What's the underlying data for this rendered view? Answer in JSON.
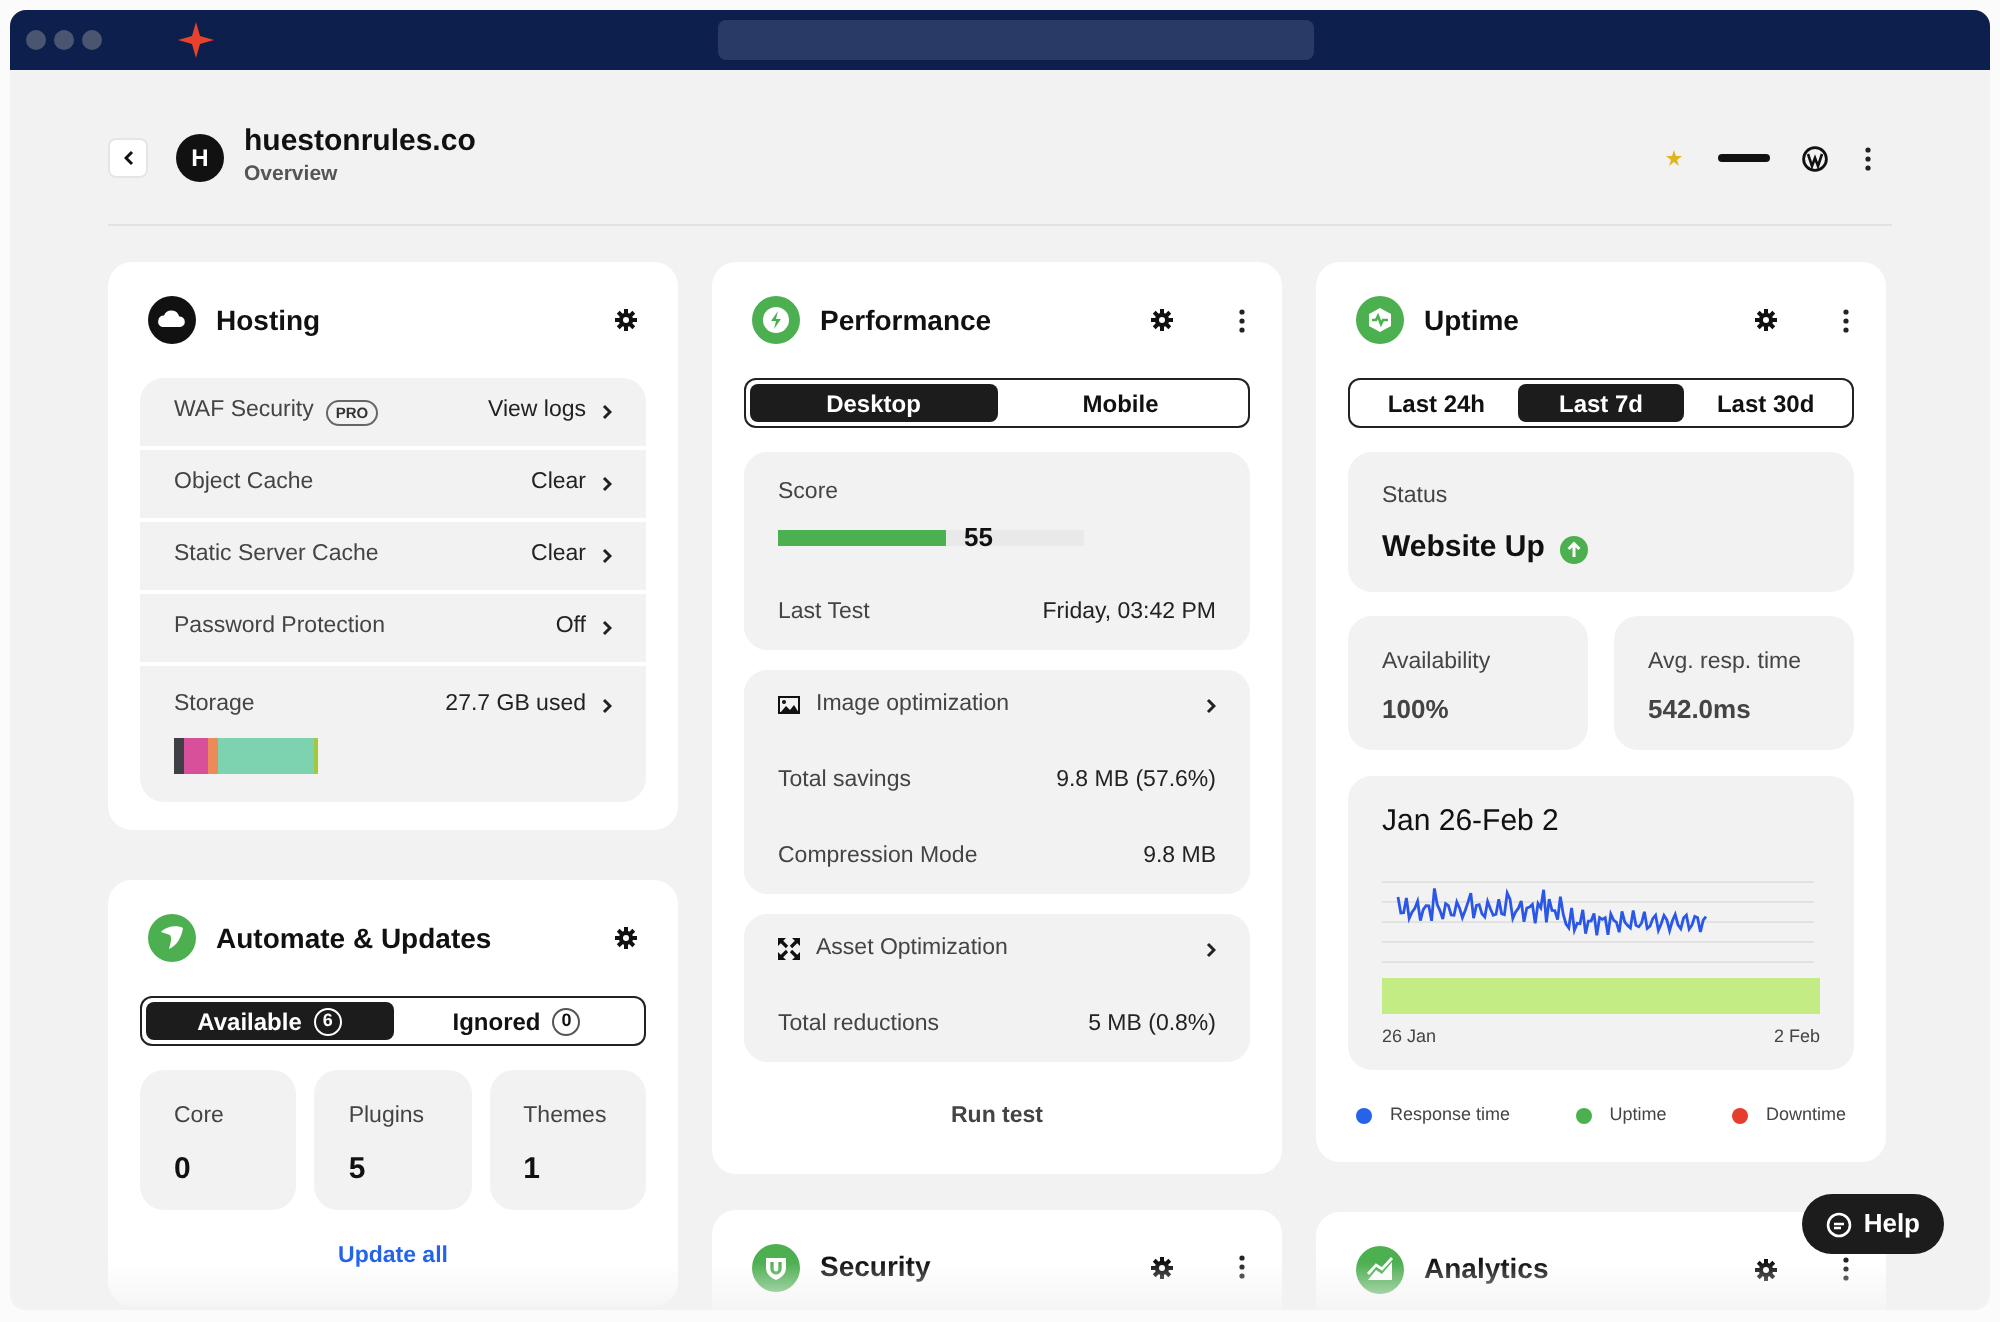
{
  "header": {
    "avatar_letter": "H",
    "site": "huestonrules.co",
    "subtitle": "Overview"
  },
  "hosting": {
    "title": "Hosting",
    "rows": [
      {
        "label": "WAF Security",
        "badge": "PRO",
        "value": "View logs"
      },
      {
        "label": "Object Cache",
        "value": "Clear"
      },
      {
        "label": "Static Server Cache",
        "value": "Clear"
      },
      {
        "label": "Password Protection",
        "value": "Off"
      }
    ],
    "storage": {
      "label": "Storage",
      "value": "27.7 GB used"
    }
  },
  "automate": {
    "title": "Automate & Updates",
    "tabs": [
      {
        "label": "Available",
        "count": "6",
        "selected": true
      },
      {
        "label": "Ignored",
        "count": "0",
        "selected": false
      }
    ],
    "stats": [
      {
        "label": "Core",
        "value": "0"
      },
      {
        "label": "Plugins",
        "value": "5"
      },
      {
        "label": "Themes",
        "value": "1"
      }
    ],
    "link": "Update all"
  },
  "performance": {
    "title": "Performance",
    "tabs": [
      {
        "label": "Desktop",
        "selected": true
      },
      {
        "label": "Mobile",
        "selected": false
      }
    ],
    "score": {
      "label": "Score",
      "value": "55",
      "level": 0.55
    },
    "last_test": {
      "label": "Last Test",
      "value": "Friday, 03:42 PM"
    },
    "groups": [
      {
        "kind": "image",
        "heading": "Image optimization",
        "rows": [
          {
            "label": "Total savings",
            "value": "9.8 MB (57.6%)"
          },
          {
            "label": "Compression Mode",
            "value": "9.8 MB"
          }
        ]
      },
      {
        "kind": "asset",
        "heading": "Asset Optimization",
        "rows": [
          {
            "label": "Total reductions",
            "value": "5 MB (0.8%)"
          }
        ]
      }
    ],
    "link": "Run test"
  },
  "security": {
    "title": "Security"
  },
  "uptime": {
    "title": "Uptime",
    "tabs": [
      {
        "label": "Last 24h",
        "selected": false
      },
      {
        "label": "Last 7d",
        "selected": true
      },
      {
        "label": "Last 30d",
        "selected": false
      }
    ],
    "status": {
      "label": "Status",
      "value": "Website Up"
    },
    "metrics": [
      {
        "label": "Availability",
        "value": "100%"
      },
      {
        "label": "Avg. resp. time",
        "value": "542.0ms"
      }
    ],
    "chart": {
      "title": "Jan 26-Feb 2",
      "start_label": "26 Jan",
      "end_label": "2 Feb"
    },
    "legend": [
      {
        "label": "Response time",
        "color": "#2563eb"
      },
      {
        "label": "Uptime",
        "color": "#4caf50"
      },
      {
        "label": "Downtime",
        "color": "#e53e2f"
      }
    ]
  },
  "analytics": {
    "title": "Analytics"
  },
  "help_button": "Help"
}
